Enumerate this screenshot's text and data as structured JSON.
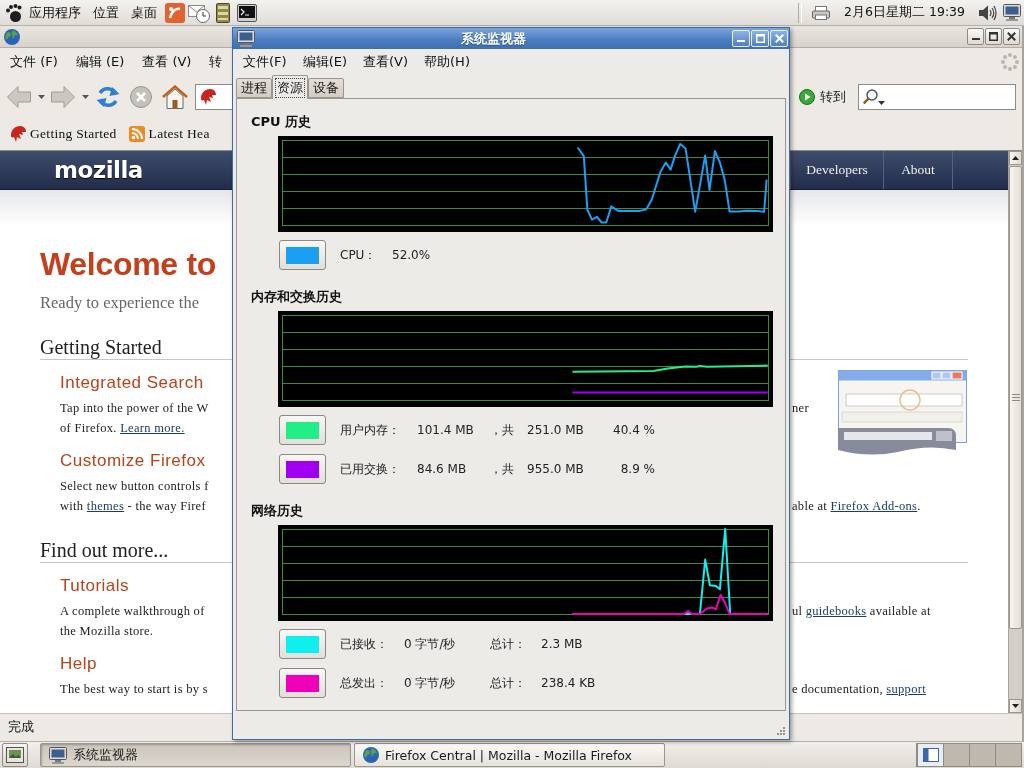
{
  "top_panel": {
    "menus": [
      "应用程序",
      "位置",
      "桌面"
    ],
    "clock": "2月6日星期二 19:39"
  },
  "browser": {
    "menu": [
      "文件 (F)",
      "编辑 (E)",
      "查看 (V)",
      "转"
    ],
    "toolbar": [
      {
        "kind": "back",
        "disabled": true
      },
      {
        "kind": "forward",
        "disabled": true
      },
      {
        "kind": "reload",
        "disabled": false
      },
      {
        "kind": "stop",
        "disabled": true
      },
      {
        "kind": "home",
        "disabled": false
      }
    ],
    "go_button": "转到",
    "bookmarks": [
      "Getting Started",
      "Latest Hea"
    ],
    "page": {
      "logo": "mozilla",
      "nav": [
        "Developers",
        "About"
      ],
      "title": "Welcome to",
      "subtitle": "Ready to experience the",
      "sections": [
        {
          "heading": "Getting Started",
          "items": [
            {
              "title": "Integrated Search",
              "lines": [
                {
                  "left": [
                    {
                      "kind": "text",
                      "text": "Tap into the power of the W"
                    }
                  ],
                  "right": [
                    {
                      "kind": "text",
                      "text": "ner"
                    }
                  ]
                },
                {
                  "left": [
                    {
                      "kind": "text",
                      "text": "of Firefox. "
                    },
                    {
                      "kind": "link",
                      "text": "Learn more."
                    }
                  ]
                }
              ]
            },
            {
              "title": "Customize Firefox",
              "lines": [
                {
                  "left": [
                    {
                      "kind": "text",
                      "text": "Select new button controls f"
                    }
                  ]
                },
                {
                  "left": [
                    {
                      "kind": "text",
                      "text": "with "
                    },
                    {
                      "kind": "link",
                      "text": "themes"
                    },
                    {
                      "kind": "text",
                      "text": " - the way Firef"
                    }
                  ],
                  "right": [
                    {
                      "kind": "text",
                      "text": "able at "
                    },
                    {
                      "kind": "link",
                      "text": "Firefox Add-ons"
                    },
                    {
                      "kind": "text",
                      "text": "."
                    }
                  ]
                }
              ]
            }
          ]
        },
        {
          "heading": "Find out more...",
          "items": [
            {
              "title": "Tutorials",
              "lines": [
                {
                  "left": [
                    {
                      "kind": "text",
                      "text": "A complete walkthrough of"
                    }
                  ],
                  "right": [
                    {
                      "kind": "text",
                      "text": "ul "
                    },
                    {
                      "kind": "link",
                      "text": "guidebooks"
                    },
                    {
                      "kind": "text",
                      "text": " available at"
                    }
                  ]
                },
                {
                  "left": [
                    {
                      "kind": "text",
                      "text": "the Mozilla store."
                    }
                  ]
                }
              ]
            },
            {
              "title": "Help",
              "lines": [
                {
                  "left": [
                    {
                      "kind": "text",
                      "text": "The best way to start is by s"
                    }
                  ],
                  "right": [
                    {
                      "kind": "text",
                      "text": "e documentation, "
                    },
                    {
                      "kind": "link",
                      "text": "support"
                    }
                  ]
                }
              ]
            }
          ]
        }
      ]
    },
    "status": "完成"
  },
  "monitor": {
    "title": "系统监视器",
    "menu": [
      "文件(F)",
      "编辑(E)",
      "查看(V)",
      "帮助(H)"
    ],
    "tabs": [
      {
        "label": "进程",
        "selected": false
      },
      {
        "label": "资源",
        "selected": true
      },
      {
        "label": "设备",
        "selected": false
      }
    ],
    "sections": [
      {
        "kind": "cpu",
        "title": "CPU 历史",
        "legend": [
          {
            "color": "#1a9ff2",
            "cells": [
              "CPU：",
              "52.0%"
            ]
          }
        ]
      },
      {
        "kind": "memory",
        "title": "内存和交换历史",
        "legend": [
          {
            "color": "#22ee88",
            "cells": [
              "用户内存：",
              "101.4 MB",
              "，共",
              "251.0 MB",
              "40.4 %"
            ]
          },
          {
            "color": "#a000f0",
            "cells": [
              "已用交换：",
              "84.6 MB",
              "，共",
              "955.0 MB",
              "8.9 %"
            ]
          }
        ]
      },
      {
        "kind": "network",
        "title": "网络历史",
        "legend": [
          {
            "color": "#10eeee",
            "cells": [
              "已接收：",
              "0 字节/秒",
              "总计：",
              "2.3 MB"
            ]
          },
          {
            "color": "#ee00bb",
            "cells": [
              "总发出：",
              "0 字节/秒",
              "总计：",
              "238.4 KB"
            ]
          }
        ]
      }
    ]
  },
  "taskbar": {
    "tasks": [
      {
        "label": "系统监视器",
        "selected": true
      },
      {
        "label": "Firefox Central | Mozilla - Mozilla Firefox",
        "selected": false
      }
    ],
    "workspaces": [
      {
        "selected": true
      },
      {
        "selected": false
      },
      {
        "selected": false
      },
      {
        "selected": false
      }
    ]
  }
}
